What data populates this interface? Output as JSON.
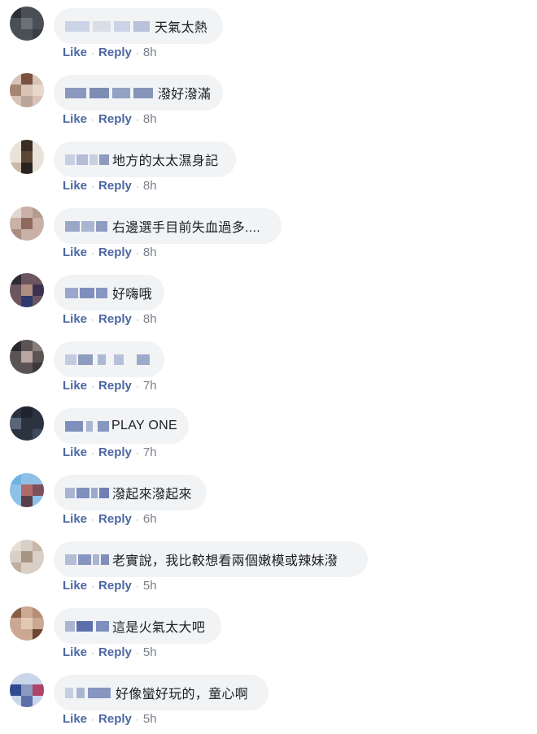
{
  "actions": {
    "like_label": "Like",
    "reply_label": "Reply",
    "separator": "·"
  },
  "comments": [
    {
      "text": "天氣太熱",
      "time": "8h"
    },
    {
      "text": "潑好潑滿",
      "time": "8h"
    },
    {
      "text": "地方的太太濕身記",
      "time": "8h"
    },
    {
      "text": "右邊選手目前失血過多....",
      "time": "8h"
    },
    {
      "text": "好嗨哦",
      "time": "8h"
    },
    {
      "text": "",
      "time": "7h"
    },
    {
      "text": "PLAY ONE",
      "time": "7h"
    },
    {
      "text": "潑起來潑起來",
      "time": "6h"
    },
    {
      "text": "老實說，我比較想看兩個嫩模或辣妹潑",
      "time": "5h"
    },
    {
      "text": "這是火氣太大吧",
      "time": "5h"
    },
    {
      "text": "好像蠻好玩的，童心啊",
      "time": "5h"
    }
  ]
}
